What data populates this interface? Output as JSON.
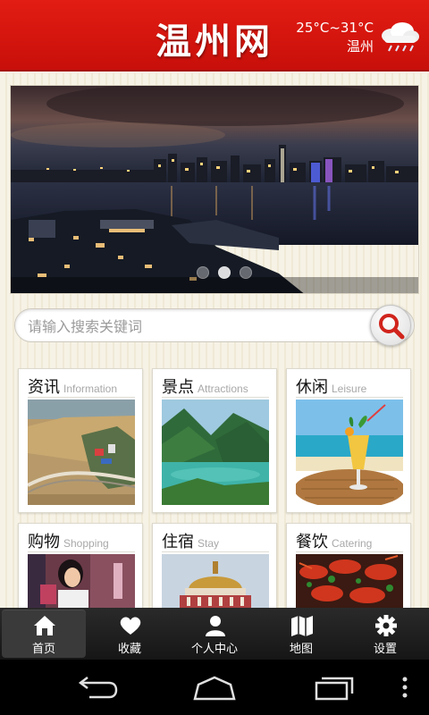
{
  "header": {
    "title": "温州网",
    "weather": {
      "temperature": "25°C~31°C",
      "city": "温州",
      "icon": "rain-cloud-icon"
    }
  },
  "banner": {
    "image": "night-city-skyline-photo",
    "page_count": 3,
    "active_page": 2
  },
  "search": {
    "placeholder": "请输入搜索关键词",
    "value": ""
  },
  "categories": [
    {
      "zh": "资讯",
      "en": "Information",
      "image": "bridge-aerial-photo"
    },
    {
      "zh": "景点",
      "en": "Attractions",
      "image": "mountain-lake-photo"
    },
    {
      "zh": "休闲",
      "en": "Leisure",
      "image": "beach-drink-photo"
    },
    {
      "zh": "购物",
      "en": "Shopping",
      "image": "shopping-woman-photo"
    },
    {
      "zh": "住宿",
      "en": "Stay",
      "image": "hotel-dome-photo"
    },
    {
      "zh": "餐饮",
      "en": "Catering",
      "image": "crayfish-dish-photo"
    }
  ],
  "tabs": [
    {
      "label": "首页",
      "icon": "home-icon",
      "active": true
    },
    {
      "label": "收藏",
      "icon": "heart-icon",
      "active": false
    },
    {
      "label": "个人中心",
      "icon": "user-icon",
      "active": false
    },
    {
      "label": "地图",
      "icon": "map-icon",
      "active": false
    },
    {
      "label": "设置",
      "icon": "gear-icon",
      "active": false
    }
  ],
  "system_nav": [
    "back-icon",
    "home-icon",
    "recents-icon",
    "overflow-menu-icon"
  ],
  "colors": {
    "header_red": "#d5140e",
    "tabbar_dark": "#1e1e1e",
    "background_cream": "#f5f1e4"
  }
}
